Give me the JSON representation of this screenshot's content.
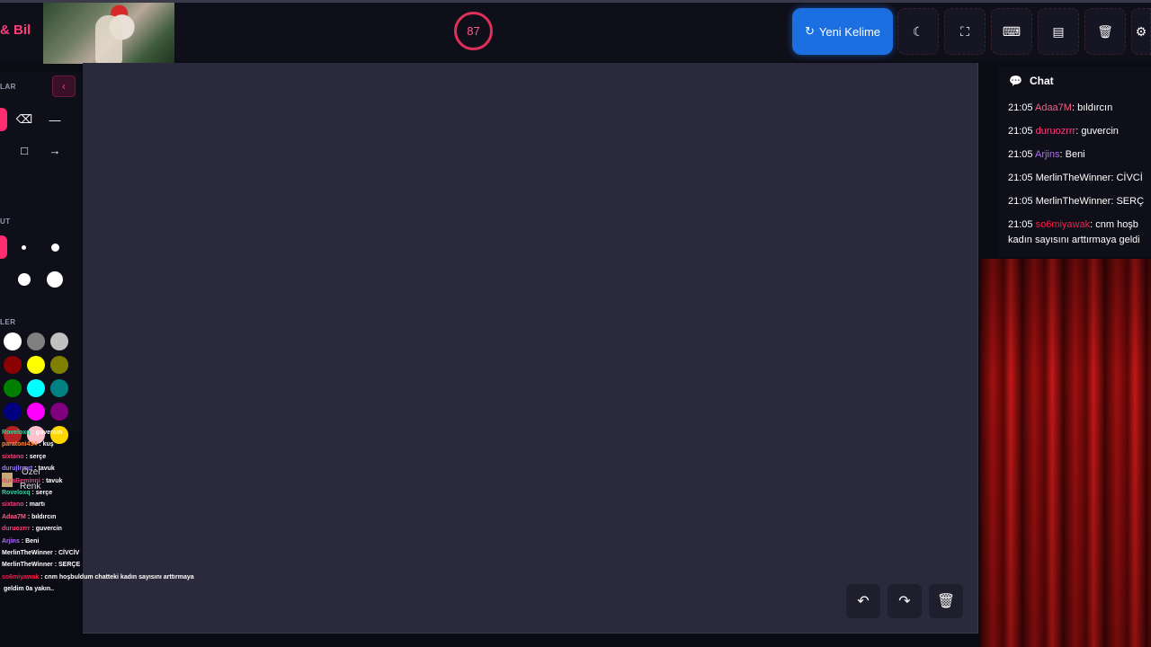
{
  "header": {
    "brand": "& Bil",
    "timer": "87",
    "new_word_label": "Yeni Kelime",
    "buttons": [
      "moon-icon",
      "fullscreen-icon",
      "keyboard-icon",
      "archive-icon",
      "trash-icon",
      "gear-icon"
    ]
  },
  "tools": {
    "section_tools": "LAR",
    "section_size": "UT",
    "section_colors": "LER",
    "custom_color": "Özel",
    "custom_color_2": "Renk",
    "colors": [
      "#ffffff",
      "#808080",
      "#c0c0c0",
      "#8b0000",
      "#ffff00",
      "#808000",
      "#008000",
      "#00ffff",
      "#008080",
      "#000080",
      "#ff00ff",
      "#800080",
      "#b22222",
      "#ffc0cb",
      "#ffd700"
    ]
  },
  "mini_chat": [
    {
      "user": "Roveloxq",
      "text": ": guvercin",
      "color": "#3ad1a0"
    },
    {
      "user": "paratoni434",
      "text": ": kuş",
      "color": "#ff8a3c"
    },
    {
      "user": "sixtano",
      "text": ": serçe",
      "color": "#ff3c78"
    },
    {
      "user": "durujlrrprt",
      "text": ": tavuk",
      "color": "#9a7aff"
    },
    {
      "user": "duraBeminni",
      "text": ": tavuk",
      "color": "#ff3c78"
    },
    {
      "user": "Roveloxq",
      "text": ": serçe",
      "color": "#3ad1a0"
    },
    {
      "user": "sixtano",
      "text": ": martı",
      "color": "#ff3c78"
    },
    {
      "user": "Adaa7M",
      "text": ": bıldırcın",
      "color": "#ff5c86"
    },
    {
      "user": "duruozrrr",
      "text": ": guvercin",
      "color": "#ff3c78"
    },
    {
      "user": "Arjins",
      "text": ": Beni",
      "color": "#b46cff"
    },
    {
      "user": "MerlinTheWinner",
      "text": ": CİVCİV",
      "color": "#ffffff"
    },
    {
      "user": "MerlinTheWinner",
      "text": ": SERÇE",
      "color": "#ffffff"
    },
    {
      "user": "so6miyawak",
      "text": ": cnm hoşbuldum chatteki kadın sayısını arttırmaya",
      "color": "#ff1a4a"
    },
    {
      "user": "",
      "text": "geldim 0a yakın..",
      "color": "#ffffff"
    }
  ],
  "chat": {
    "title": "Chat",
    "messages": [
      {
        "time": "21:05",
        "user": "Adaa7M",
        "text": ": bıldırcın",
        "color": "#ff5c86"
      },
      {
        "time": "21:05",
        "user": "duruozrrr",
        "text": ": guvercin",
        "color": "#ff3c78"
      },
      {
        "time": "21:05",
        "user": "Arjins",
        "text": ": Beni",
        "color": "#b46cff"
      },
      {
        "time": "21:05",
        "user": "MerlinTheWinner",
        "text": ": CİVCİ",
        "color": "#ffffff"
      },
      {
        "time": "21:05",
        "user": "MerlinTheWinner",
        "text": ": SERÇ",
        "color": "#ffffff"
      },
      {
        "time": "21:05",
        "user": "so6miyawak",
        "text": ": cnm hoşb",
        "color": "#ff1a4a",
        "text2": "kadın sayısını arttırmaya geldi"
      }
    ]
  },
  "canvas_controls": [
    "undo-icon",
    "redo-icon",
    "trash-icon"
  ]
}
